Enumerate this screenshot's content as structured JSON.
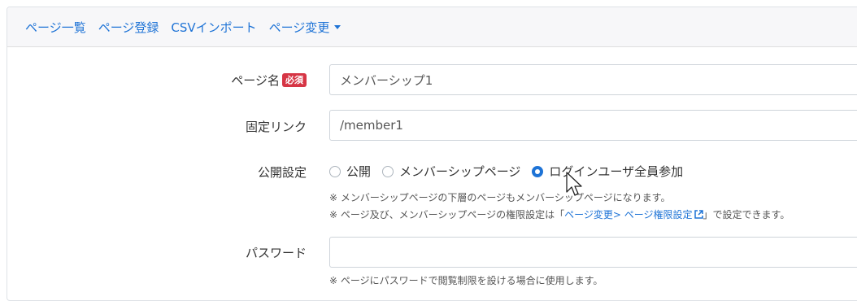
{
  "nav": {
    "items": [
      "ページ一覧",
      "ページ登録",
      "CSVインポート",
      "ページ変更"
    ]
  },
  "form": {
    "page_name": {
      "label": "ページ名",
      "required_badge": "必須",
      "value": "メンバーシップ1"
    },
    "permalink": {
      "label": "固定リンク",
      "value": "/member1"
    },
    "visibility": {
      "label": "公開設定",
      "options": [
        {
          "label": "公開",
          "checked": false
        },
        {
          "label": "メンバーシップページ",
          "checked": false
        },
        {
          "label": "ログインユーザ全員参加",
          "checked": true
        }
      ],
      "help1": "※ メンバーシップページの下層のページもメンバーシップページになります。",
      "help2_prefix": "※ ページ及び、メンバーシップページの権限設定は「",
      "help2_link": "ページ変更> ページ権限設定",
      "help2_suffix": "」で設定できます。"
    },
    "password": {
      "label": "パスワード",
      "value": "",
      "help": "※ ページにパスワードで閲覧制限を設ける場合に使用します。"
    }
  },
  "colors": {
    "link": "#1e73d6",
    "badge": "#d63545",
    "radio_checked": "#1e73d6"
  }
}
